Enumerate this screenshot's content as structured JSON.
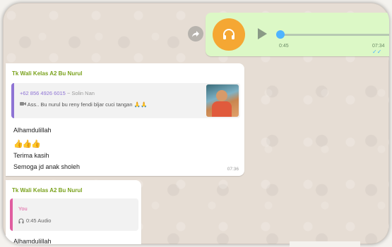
{
  "voice_message": {
    "duration_played": "0:45",
    "time": "07:34",
    "status_icon": "double-check-icon",
    "progress": 0.0
  },
  "message1": {
    "sender": "Tk Wali Kelas A2 Bu Nurul",
    "quote": {
      "author_number": "+62 856 4926 6015",
      "author_aka": "~ Solin Nan",
      "text": "Ass.. Bu nurul bu reny fendi bljar cuci tangan",
      "text_emoji": "🙏🙏",
      "media_icon": "video-icon"
    },
    "lines": [
      "Alhamdulillah",
      "👍👍👍",
      "Terima kasih",
      "Semoga jd anak sholeh"
    ],
    "time": "07:36"
  },
  "message2": {
    "sender": "Tk Wali Kelas A2 Bu Nurul",
    "quote": {
      "author": "You",
      "text": "0:45 Audio",
      "media_icon": "headphones-icon"
    },
    "body": "Alhamdulillah"
  }
}
